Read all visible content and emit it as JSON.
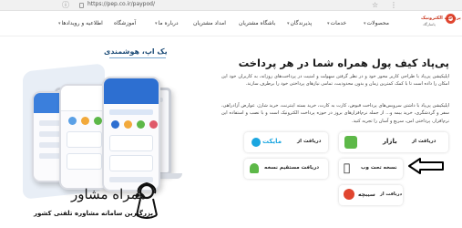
{
  "browser": {
    "url": "https://pep.co.ir/paypod/"
  },
  "nav": {
    "items": [
      {
        "label": "محصولات",
        "has_dropdown": true
      },
      {
        "label": "خدمات",
        "has_dropdown": true
      },
      {
        "label": "پذیرندگان",
        "has_dropdown": true
      },
      {
        "label": "باشگاه مشتریان",
        "has_dropdown": false
      },
      {
        "label": "امداد مشتریان",
        "has_dropdown": false
      },
      {
        "label": "درباره ما",
        "has_dropdown": true
      },
      {
        "label": "آموزشگاه",
        "has_dropdown": false
      },
      {
        "label": "اطلاعیه و رویدادها",
        "has_dropdown": true
      }
    ],
    "logo_line1": "پرداخت الکترونیک",
    "logo_line2": "پاسارگاد"
  },
  "hero": {
    "headline": "پی‌پاد کیف پول همراه شما در هر پرداخت",
    "paragraph1": "اپلیکیشن پی‌پاد با طراحی کاربر محور خود و در نظر گرفتن سهولت و امنیت در پرداخت‌های روزانه، به کاربران خود این امکان را داده است تا با کمک کمترین زمان و بدون محدودیت، تمامی نیازهای پرداختی خود را برطرف سازند.",
    "paragraph2": "اپلیکیشن پی‌پاد با داشتن سرویس‌های پرداخت قبوض، کارت به کارت، خرید بسته اینترنت، خرید شارژ، عوارض آزادراهی، سفر و گردشگری، خرید بیمه و... از جمله نرم‌افزارهای بروز در حوزه پرداخت الکترونیک است و با نصب و استفاده این نرم‌افزار، پرداختی امن، سریع و آسان را تجربه کنید."
  },
  "downloads": {
    "bazaar": {
      "label": "دریافت از",
      "brand": "بازار"
    },
    "myket": {
      "label": "دریافت از",
      "brand": "مایکت"
    },
    "webapp": {
      "label": "نسخه تحت وب"
    },
    "direct": {
      "label": "دریافت مستقیم نسخه"
    },
    "sibche": {
      "label": "دریافت از",
      "brand": "سیبچه"
    }
  },
  "left": {
    "section_title": "یک اپ، هوشمندی"
  },
  "watermark": {
    "title": "همراه مشاور",
    "subtitle": "بزرگترین سامانه مشاوره تلفنی کشور"
  },
  "colors": {
    "accent_blue": "#2d6fd1",
    "bazaar_green": "#5db848",
    "myket_blue": "#1ba6e0",
    "brand_red": "#e0452f"
  }
}
